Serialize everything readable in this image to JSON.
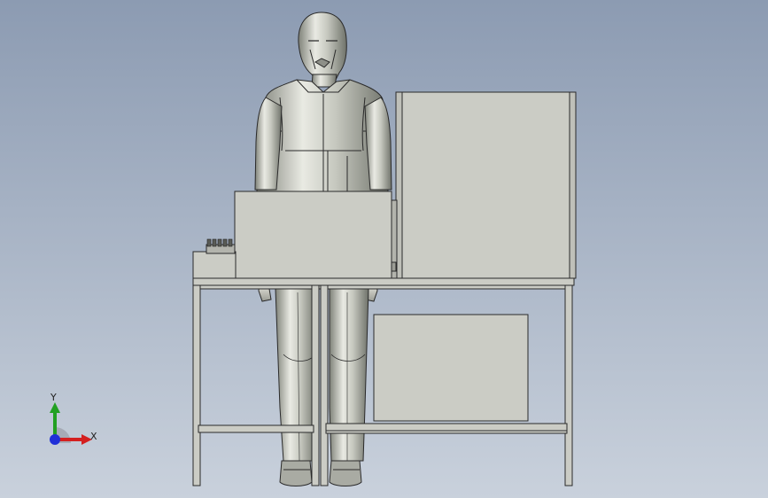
{
  "viewport": {
    "background_top": "#8c9bb2",
    "background_bottom": "#c9d1dc"
  },
  "model": {
    "body_color": "#c9cac3",
    "edge_color": "#2a2a2a",
    "mannequin_color": "#b8bab2"
  },
  "triad": {
    "x_label": "X",
    "y_label": "Y",
    "x_color": "#d42020",
    "y_color": "#22a022",
    "z_color": "#2030d8"
  }
}
